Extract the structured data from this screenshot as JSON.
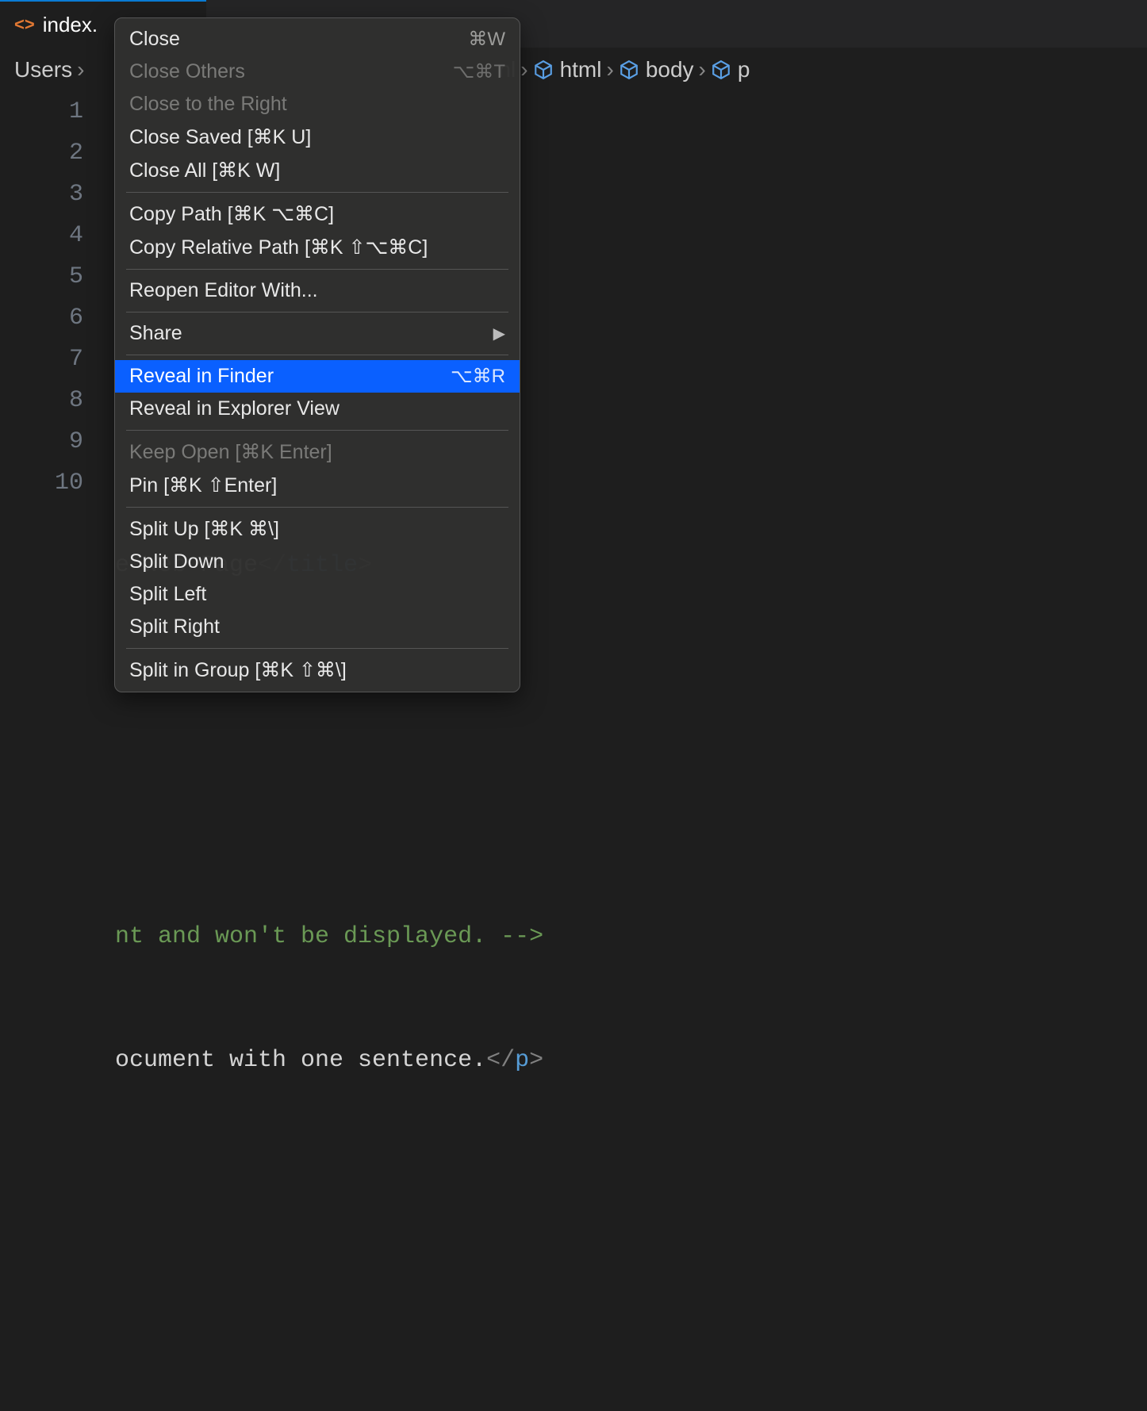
{
  "tab": {
    "filename": "index."
  },
  "breadcrumb": {
    "root": "Users",
    "nl_partial": "nl",
    "items": [
      "html",
      "body",
      "p"
    ]
  },
  "gutter": {
    "lines": [
      "1",
      "2",
      "3",
      "4",
      "5",
      "6",
      "7",
      "8",
      "9",
      "10"
    ]
  },
  "code": {
    "line4_title_text": "e Web Page",
    "line4_close_tag": "title",
    "line7_comment": "nt and won't be displayed. -->",
    "line8_text": "ocument with one sentence.",
    "line8_close_tag": "p"
  },
  "context_menu": {
    "close": {
      "label": "Close",
      "shortcut": "⌘W"
    },
    "close_others": {
      "label": "Close Others",
      "shortcut": "⌥⌘T"
    },
    "close_right": {
      "label": "Close to the Right"
    },
    "close_saved": {
      "label": "Close Saved [⌘K U]"
    },
    "close_all": {
      "label": "Close All [⌘K W]"
    },
    "copy_path": {
      "label": "Copy Path [⌘K ⌥⌘C]"
    },
    "copy_rel_path": {
      "label": "Copy Relative Path [⌘K ⇧⌥⌘C]"
    },
    "reopen_with": {
      "label": "Reopen Editor With..."
    },
    "share": {
      "label": "Share"
    },
    "reveal_finder": {
      "label": "Reveal in Finder",
      "shortcut": "⌥⌘R"
    },
    "reveal_explorer": {
      "label": "Reveal in Explorer View"
    },
    "keep_open": {
      "label": "Keep Open [⌘K Enter]"
    },
    "pin": {
      "label": "Pin [⌘K ⇧Enter]"
    },
    "split_up": {
      "label": "Split Up [⌘K ⌘\\]"
    },
    "split_down": {
      "label": "Split Down"
    },
    "split_left": {
      "label": "Split Left"
    },
    "split_right": {
      "label": "Split Right"
    },
    "split_in_group": {
      "label": "Split in Group [⌘K ⇧⌘\\]"
    }
  }
}
